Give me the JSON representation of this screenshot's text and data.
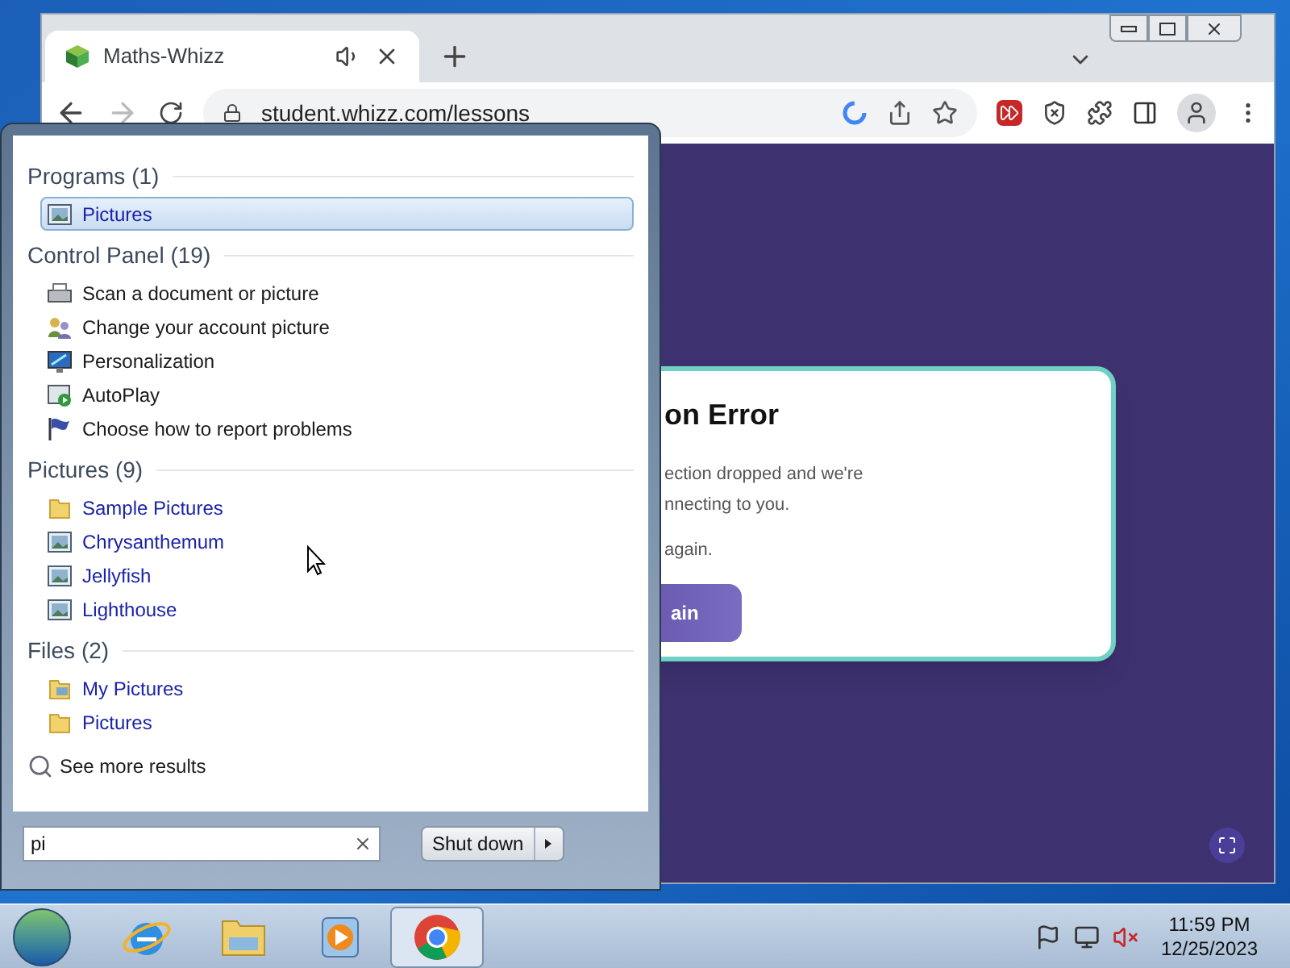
{
  "browser": {
    "tab": {
      "title": "Maths-Whizz"
    },
    "address": "student.whizz.com/lessons"
  },
  "page": {
    "card": {
      "title": "on Error",
      "lines": [
        "ection dropped and we're",
        "nnecting to you."
      ],
      "note": "again.",
      "button": "ain"
    }
  },
  "start_menu": {
    "groups": [
      {
        "heading": "Programs (1)",
        "kind": "program",
        "items": [
          {
            "label": "Pictures",
            "kind": "image",
            "selected": true
          }
        ]
      },
      {
        "heading": "Control Panel (19)",
        "kind": "control_panel",
        "items": [
          {
            "label": "Scan a document or picture",
            "kind": "scanner",
            "selected": false
          },
          {
            "label": "Change your account picture",
            "kind": "users",
            "selected": false
          },
          {
            "label": "Personalization",
            "kind": "display",
            "selected": false
          },
          {
            "label": "AutoPlay",
            "kind": "autoplay",
            "selected": false
          },
          {
            "label": "Choose how to report problems",
            "kind": "flag",
            "selected": false
          }
        ]
      },
      {
        "heading": "Pictures (9)",
        "kind": "file",
        "items": [
          {
            "label": "Sample Pictures",
            "kind": "folder",
            "selected": false
          },
          {
            "label": "Chrysanthemum",
            "kind": "image",
            "selected": false
          },
          {
            "label": "Jellyfish",
            "kind": "image",
            "selected": false
          },
          {
            "label": "Lighthouse",
            "kind": "image",
            "selected": false
          }
        ]
      },
      {
        "heading": "Files (2)",
        "kind": "file",
        "items": [
          {
            "label": "My Pictures",
            "kind": "folder_image",
            "selected": false
          },
          {
            "label": "Pictures",
            "kind": "folder",
            "selected": false
          }
        ]
      }
    ],
    "see_more": "See more results",
    "search": {
      "value": "pi"
    },
    "shutdown": "Shut down"
  },
  "taskbar": {
    "apps": [
      {
        "kind": "ie",
        "selected": false
      },
      {
        "kind": "explorer",
        "selected": false
      },
      {
        "kind": "media",
        "selected": false
      },
      {
        "kind": "chrome",
        "selected": true
      }
    ],
    "time": "11:59 PM",
    "date": "12/25/2023"
  }
}
